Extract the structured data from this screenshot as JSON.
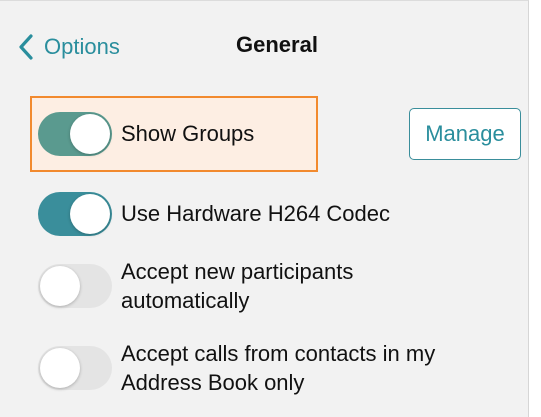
{
  "header": {
    "back_label": "Options",
    "title": "General"
  },
  "settings": [
    {
      "label": "Show Groups",
      "enabled": true,
      "highlighted": true
    },
    {
      "label": "Use Hardware H264 Codec",
      "enabled": true
    },
    {
      "label": "Accept new participants automatically",
      "enabled": false
    },
    {
      "label": "Accept calls from contacts in my Address Book only",
      "enabled": false
    }
  ],
  "manage_button": {
    "label": "Manage"
  },
  "colors": {
    "accent": "#2a8e9d",
    "toggle_on": "#3a8e9b",
    "toggle_off": "#e4e4e4",
    "highlight_fill": "#fdeee3",
    "highlight_border": "#f28a2e"
  }
}
